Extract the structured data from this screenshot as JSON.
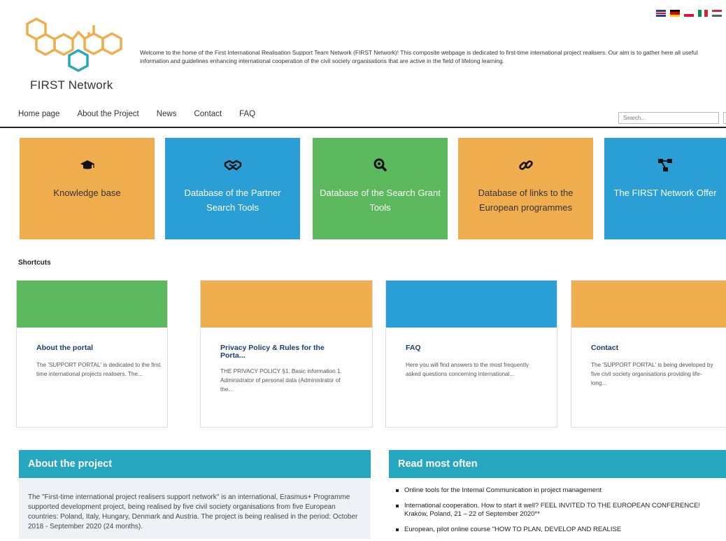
{
  "header": {
    "logo_text": "FIRST Network",
    "welcome_text": "Welcome to the home of the First International Realisation Support Team Network (FIRST Network)! This composite webpage is dedicated to first-time international project realisers. Our aim is to gather here all useful information and guidelines enhancing international cooperation of the civil society organisations that are active in the field of lifelong learning.",
    "languages": [
      "English",
      "German",
      "Polish",
      "Italian",
      "Hungarian"
    ]
  },
  "nav": {
    "items": [
      "Home page",
      "About the Project",
      "News",
      "Contact",
      "FAQ"
    ],
    "search_placeholder": "Search..."
  },
  "tiles": [
    {
      "label": "Knowledge base",
      "icon": "graduation-cap-icon",
      "color": "#f0ad4e"
    },
    {
      "label": "Database of the Partner Search Tools",
      "icon": "handshake-icon",
      "color": "#2a9fd6"
    },
    {
      "label": "Database of the Search Grant Tools",
      "icon": "search-icon",
      "color": "#5cb85c"
    },
    {
      "label": "Database of links to the European programmes",
      "icon": "link-icon",
      "color": "#f0ad4e"
    },
    {
      "label": "The FIRST Network Offer",
      "icon": "network-icon",
      "color": "#2a9fd6"
    }
  ],
  "shortcuts": {
    "title": "Shortcuts",
    "cards": [
      {
        "title": "About the portal",
        "desc": "The 'SUPPORT PORTAL' is dedicated to the first time international projects realisers. The...",
        "color": "#5cb85c"
      },
      {
        "title": "Privacy Policy & Rules for the Porta...",
        "desc": "THE PRIVACY POLICY §1. Basic information 1. Administrator of personal data (Administrator of the...",
        "color": "#f0ad4e"
      },
      {
        "title": "FAQ",
        "desc": "Here you will find answers to the most frequently asked questions concerning international...",
        "color": "#2a9fd6"
      },
      {
        "title": "Contact",
        "desc": "The 'SUPPORT PORTAL' is being developed by five civil society organisations providing life-long...",
        "color": "#f0ad4e"
      }
    ]
  },
  "about_project": {
    "heading": "About the project",
    "color": "#26a6bf",
    "text": "The \"First-time international project realisers support network\" is an international, Erasmus+ Programme supported development project, being realised by five civil society organisations from five European countries: Poland, Italy, Hungary, Denmark and Austria. The project is being realised in the period: October 2018 - September 2020 (24 months)."
  },
  "read_most": {
    "heading": "Read most often",
    "color": "#26a6bf",
    "items": [
      "Online tools for the Internal Communication in project management",
      "International cooperation. How to start it well? FEEL INVITED TO THE EUROPEAN CONFERENCE! Kraków, Poland, 21 – 22 of September 2020**",
      "European, pilot online course \"HOW TO PLAN, DEVELOP AND REALISE"
    ]
  }
}
